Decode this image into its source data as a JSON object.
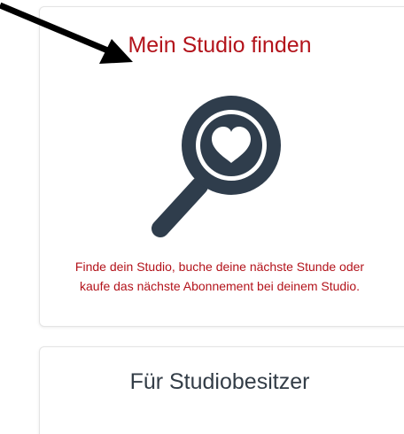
{
  "studio_card": {
    "title": "Mein Studio finden",
    "description_line1": "Finde dein Studio, buche deine nächste Stunde oder",
    "description_line2": "kaufe das nächste Abonnement bei deinem Studio.",
    "icon": "magnifier-heart-icon"
  },
  "owner_card": {
    "title": "Für Studiobesitzer"
  },
  "annotation": {
    "icon": "arrow-pointer-icon"
  },
  "colors": {
    "accent_red": "#b3131b",
    "icon_dark": "#2f3d4c",
    "heading_dark": "#333d47",
    "border": "#e4e4e4"
  }
}
